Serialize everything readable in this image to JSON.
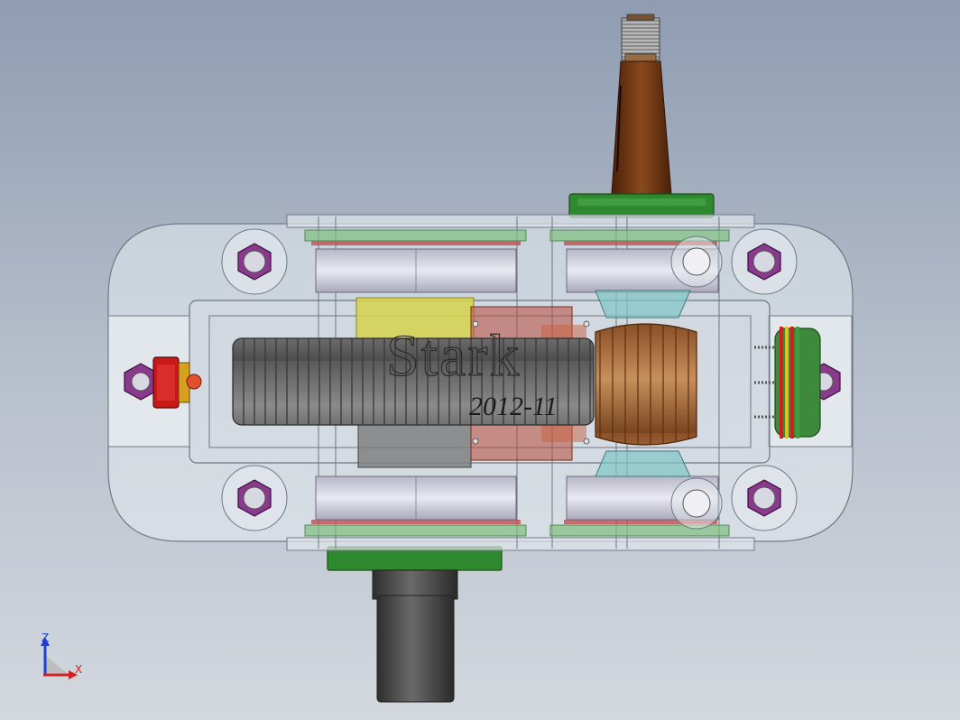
{
  "model": {
    "engraving_title": "Stark",
    "engraving_date": "2012-11"
  },
  "triad": {
    "z_label": "Z",
    "x_label": "X"
  },
  "colors": {
    "background_top": "#8f9cb2",
    "background_bottom": "#d3d8de",
    "housing_glass": "#e6ecf0",
    "nut_purple": "#8a3a8c",
    "shaft_brown": "#7a3b12",
    "flange_green": "#2f8a2f",
    "plug_red": "#c81818",
    "bearing_gray": "#c8c8d8",
    "worm_gray": "#6f6f6f",
    "worm_gear_bronze": "#b67a4a",
    "spacer_yellow": "#d6d24a"
  },
  "icons": [
    "axis-triad-icon",
    "hex-nut-icon",
    "drain-plug-icon",
    "sight-glass-icon"
  ]
}
